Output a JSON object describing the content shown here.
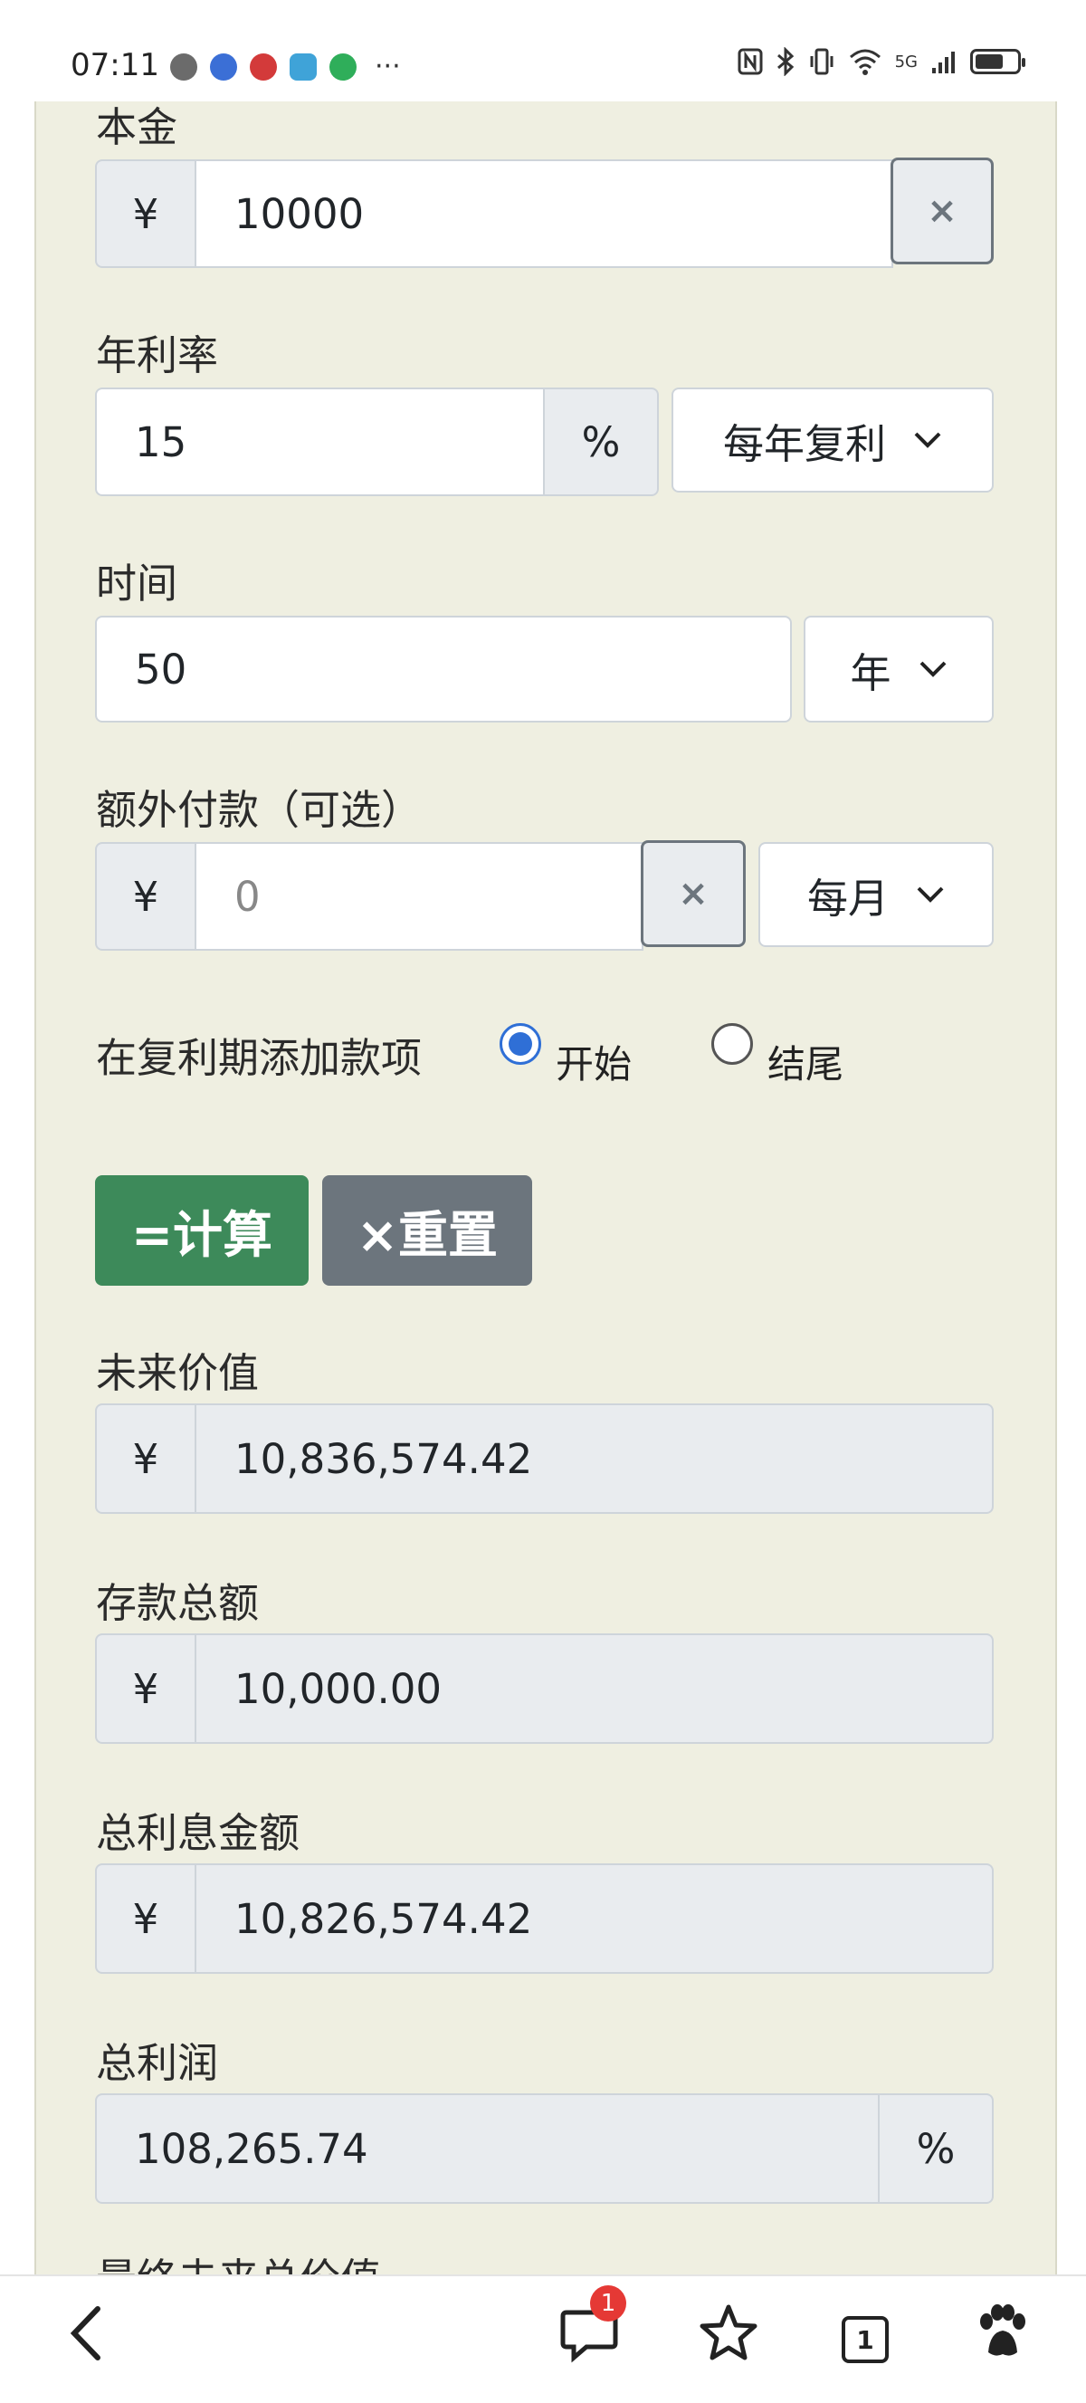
{
  "status_bar": {
    "time": "07:11",
    "more": "···",
    "network": "5G"
  },
  "form": {
    "principal": {
      "label": "本金",
      "currency": "¥",
      "value": "10000",
      "clear": "×"
    },
    "annual_rate": {
      "label": "年利率",
      "value": "15",
      "unit": "%",
      "compounding": "每年复利"
    },
    "time": {
      "label": "时间",
      "value": "50",
      "unit": "年"
    },
    "extra_payment": {
      "label": "额外付款（可选）",
      "currency": "¥",
      "placeholder": "0",
      "clear": "×",
      "frequency": "每月"
    },
    "add_payment": {
      "label": "在复利期添加款项",
      "option_start": "开始",
      "option_end": "结尾",
      "selected": "开始"
    },
    "buttons": {
      "calculate": "=计算",
      "reset": "×重置"
    }
  },
  "results": {
    "future_value": {
      "label": "未来价值",
      "currency": "¥",
      "value": "10,836,574.42"
    },
    "total_deposits": {
      "label": "存款总额",
      "currency": "¥",
      "value": "10,000.00"
    },
    "total_interest": {
      "label": "总利息金额",
      "currency": "¥",
      "value": "10,826,574.42"
    },
    "total_profit": {
      "label": "总利润",
      "value": "108,265.74",
      "unit": "%"
    },
    "final_future_total": {
      "label": "最终未来总价值"
    }
  },
  "bottom_nav": {
    "badge_count": "1",
    "tab_count": "1"
  }
}
